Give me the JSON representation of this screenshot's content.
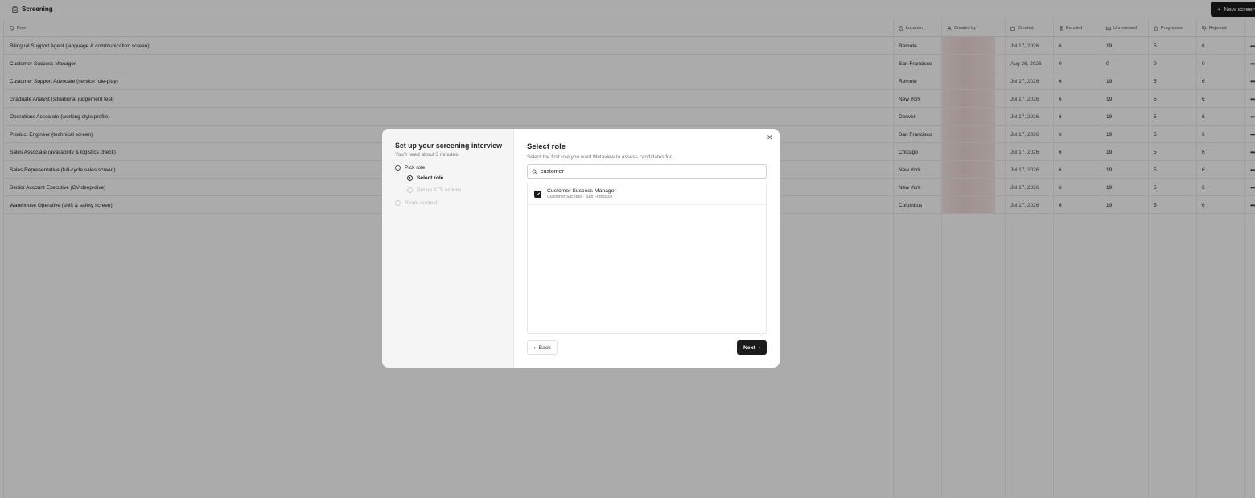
{
  "app": {
    "title": "Screening",
    "new_button": "New screen"
  },
  "table": {
    "headers": {
      "role": "Role",
      "location": "Location",
      "created_by": "Created by",
      "created": "Created",
      "enrolled": "Enrolled",
      "unreviewed": "Unreviewed",
      "progressed": "Progressed",
      "rejected": "Rejected"
    },
    "rows": [
      {
        "role": "Bilingual Support Agent (language & communication screen)",
        "location": "Remote",
        "created": "Jul 17, 2026",
        "enrolled": "6",
        "unreviewed": "19",
        "progressed": "5",
        "rejected": "6"
      },
      {
        "role": "Customer Success Manager",
        "location": "San Francisco",
        "created": "Aug 26, 2026",
        "enrolled": "0",
        "unreviewed": "0",
        "progressed": "0",
        "rejected": "0"
      },
      {
        "role": "Customer Support Advocate (service role-play)",
        "location": "Remote",
        "created": "Jul 17, 2026",
        "enrolled": "6",
        "unreviewed": "19",
        "progressed": "5",
        "rejected": "6"
      },
      {
        "role": "Graduate Analyst (situational judgement test)",
        "location": "New York",
        "created": "Jul 17, 2026",
        "enrolled": "6",
        "unreviewed": "19",
        "progressed": "5",
        "rejected": "6"
      },
      {
        "role": "Operations Associate (working style profile)",
        "location": "Denver",
        "created": "Jul 17, 2026",
        "enrolled": "6",
        "unreviewed": "19",
        "progressed": "5",
        "rejected": "6"
      },
      {
        "role": "Product Engineer (technical screen)",
        "location": "San Francisco",
        "created": "Jul 17, 2026",
        "enrolled": "6",
        "unreviewed": "19",
        "progressed": "5",
        "rejected": "6"
      },
      {
        "role": "Sales Associate (availability & logistics check)",
        "location": "Chicago",
        "created": "Jul 17, 2026",
        "enrolled": "6",
        "unreviewed": "19",
        "progressed": "5",
        "rejected": "6"
      },
      {
        "role": "Sales Representative (full-cycle sales screen)",
        "location": "New York",
        "created": "Jul 17, 2026",
        "enrolled": "6",
        "unreviewed": "19",
        "progressed": "5",
        "rejected": "6"
      },
      {
        "role": "Senior Account Executive (CV deep-dive)",
        "location": "New York",
        "created": "Jul 17, 2026",
        "enrolled": "6",
        "unreviewed": "19",
        "progressed": "5",
        "rejected": "6"
      },
      {
        "role": "Warehouse Operative (shift & safety screen)",
        "location": "Columbus",
        "created": "Jul 17, 2026",
        "enrolled": "6",
        "unreviewed": "19",
        "progressed": "5",
        "rejected": "6"
      }
    ],
    "row_menu": "•••"
  },
  "modal": {
    "left": {
      "title": "Set up your screening interview",
      "subtitle": "You'll need about 3 minutes.",
      "steps": {
        "pick_role": "Pick role",
        "select_role": "Select role",
        "ats_actions": "Set up ATS actions",
        "share_context": "Share context"
      }
    },
    "right": {
      "title": "Select role",
      "subtitle": "Select the first role you want Metaview to assess candidates for.",
      "search_value": "customer",
      "close": "✕",
      "options": [
        {
          "title": "Customer Success Manager",
          "meta": "Customer Success · San Francisco",
          "checked": true
        }
      ],
      "back_label": "Back",
      "next_label": "Next"
    }
  }
}
